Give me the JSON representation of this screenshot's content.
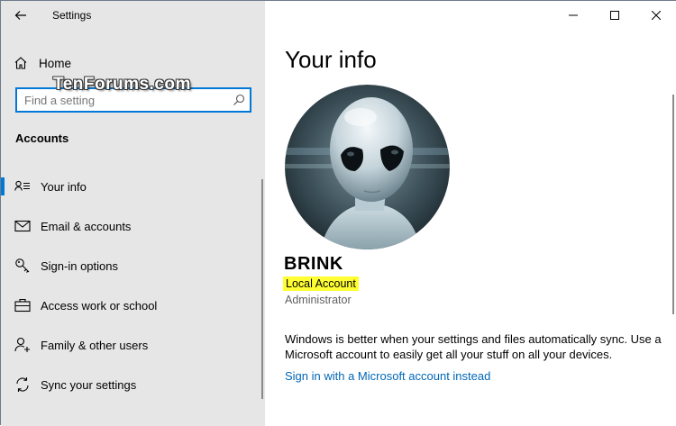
{
  "app": {
    "title": "Settings"
  },
  "sidebar": {
    "home_label": "Home",
    "search_placeholder": "Find a setting",
    "section_title": "Accounts",
    "watermark": "TenForums.com",
    "items": [
      {
        "label": "Your info",
        "icon": "person-card-icon",
        "active": true
      },
      {
        "label": "Email & accounts",
        "icon": "mail-icon",
        "active": false
      },
      {
        "label": "Sign-in options",
        "icon": "key-icon",
        "active": false
      },
      {
        "label": "Access work or school",
        "icon": "briefcase-icon",
        "active": false
      },
      {
        "label": "Family & other users",
        "icon": "person-add-icon",
        "active": false
      },
      {
        "label": "Sync your settings",
        "icon": "sync-icon",
        "active": false
      }
    ]
  },
  "main": {
    "title": "Your info",
    "user_name": "BRINK",
    "account_type": "Local Account",
    "account_role": "Administrator",
    "sync_text": "Windows is better when your settings and files automatically sync. Use a Microsoft account to easily get all your stuff on all your devices.",
    "sync_link": "Sign in with a Microsoft account instead"
  },
  "colors": {
    "accent": "#0078d7",
    "link": "#0067b8",
    "sidebar_bg": "#e6e6e6",
    "highlight": "#ffff33"
  }
}
